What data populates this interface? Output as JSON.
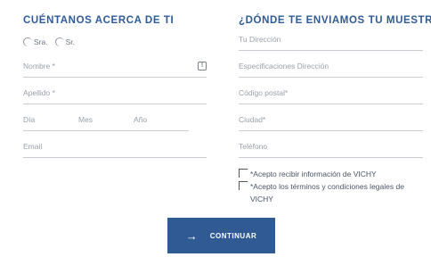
{
  "left": {
    "heading": "CUÉNTANOS ACERCA DE TI",
    "salutations": [
      "Sra.",
      "Sr."
    ],
    "fields": {
      "nombre": "Nombre *",
      "apellido": "Apellido *",
      "dia": "Día",
      "mes": "Mes",
      "anio": "Año",
      "email": "Email"
    },
    "nombre_info_icon": "info-icon"
  },
  "right": {
    "heading": "¿DÓNDE TE ENVIAMOS TU MUESTRA?",
    "fields": {
      "direccion": "Tu Dirección",
      "especificaciones": "Especificaciones Dirección",
      "codigo_postal": "Código postal*",
      "ciudad": "Ciudad*",
      "telefono": "Teléfono"
    },
    "consents": [
      "*Acepto recibir información de VICHY",
      "*Acepto los términos y condiciones legales de VICHY"
    ]
  },
  "button": {
    "label": "CONTINUAR",
    "icon": "arrow-right-icon"
  },
  "colors": {
    "accent": "#2f5a94",
    "text_muted": "#9aa0a8",
    "rule": "#c9ccd2"
  }
}
